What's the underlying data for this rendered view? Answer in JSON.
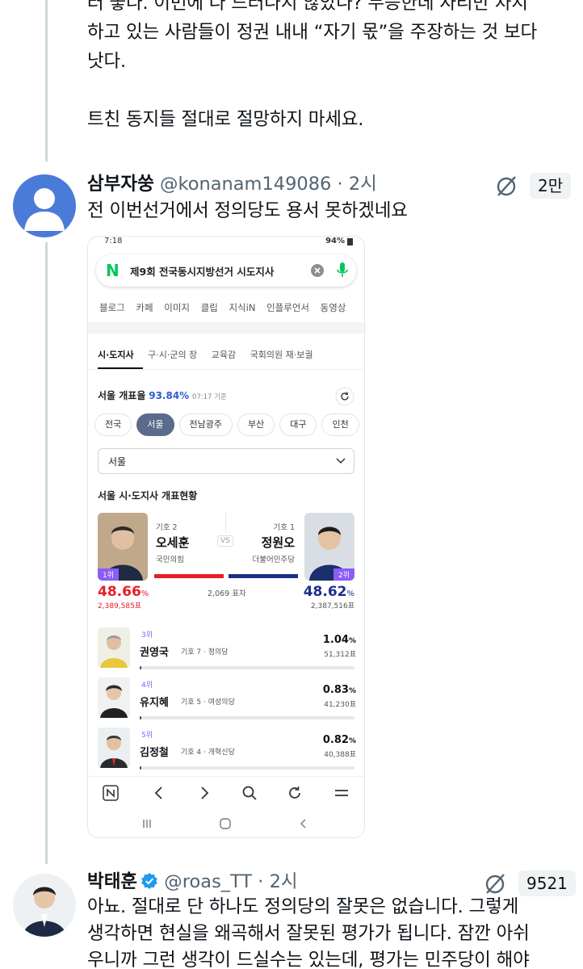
{
  "thread_top": {
    "lines": [
      "러 좋다. 이번에 다 드러나지 않았나? 무능한데 자리만 차지",
      "하고 있는 사람들이 정권 내내 “자기 몫”을 주장하는 것 보다",
      "낫다."
    ],
    "closing": "트친 동지들 절대로 절망하지 마세요."
  },
  "tweet1": {
    "name": "삼부자쑹",
    "handle": "@konanam149086",
    "time": "· 2시",
    "views": "2만",
    "text": "전 이번선거에서 정의당도 용서 못하겠네요"
  },
  "screenshot": {
    "status_time": "7:18",
    "status_right": "94%",
    "search_query": "제9회 전국동시지방선거 시도지사",
    "tabs": [
      "블로그",
      "카페",
      "이미지",
      "클립",
      "지식iN",
      "인플루언서",
      "동영상"
    ],
    "subtabs": [
      "시·도지사",
      "구·시·군의 장",
      "교육감",
      "국회의원 재·보궐"
    ],
    "rate_label": "서울 개표율",
    "rate_value": "93.84%",
    "rate_time": "07:17 기준",
    "regions": [
      "전국",
      "서울",
      "전남광주",
      "부산",
      "대구",
      "인천"
    ],
    "dropdown_value": "서울",
    "section_title": "서울 시·도지사 개표현황",
    "vs": "VS",
    "margin": "2,069 표차",
    "cand1": {
      "num": "기호 2",
      "name": "오세훈",
      "party": "국민의힘",
      "rank": "1위",
      "pct": "48.66",
      "votes": "2,389,585표",
      "color": "#e61e2b"
    },
    "cand2": {
      "num": "기호 1",
      "name": "정원오",
      "party": "더불어민주당",
      "rank": "2위",
      "pct": "48.62",
      "votes": "2,387,516표",
      "color": "#1a2f8c"
    },
    "minor": [
      {
        "rank": "3위",
        "name": "권영국",
        "info": "기호 7 · 정의당",
        "pct": "1.04",
        "votes": "51,312표",
        "share": 1.04
      },
      {
        "rank": "4위",
        "name": "유지혜",
        "info": "기호 5 · 여성의당",
        "pct": "0.83",
        "votes": "41,230표",
        "share": 0.83
      },
      {
        "rank": "5위",
        "name": "김정철",
        "info": "기호 4 · 개혁신당",
        "pct": "0.82",
        "votes": "40,388표",
        "share": 0.82
      }
    ],
    "pct_sign": "%"
  },
  "tweet2": {
    "name": "박태훈",
    "handle": "@roas_TT",
    "time": "· 2시",
    "views": "9521",
    "lines": [
      "아뇨. 절대로 단 하나도 정의당의 잘못은 없습니다. 그렇게",
      "생각하면 현실을 왜곡해서 잘못된 평가가 됩니다. 잠깐 아쉬",
      "우니까 그런 생각이 드실수는 있는데, 평가는 민주당이 해야"
    ]
  }
}
